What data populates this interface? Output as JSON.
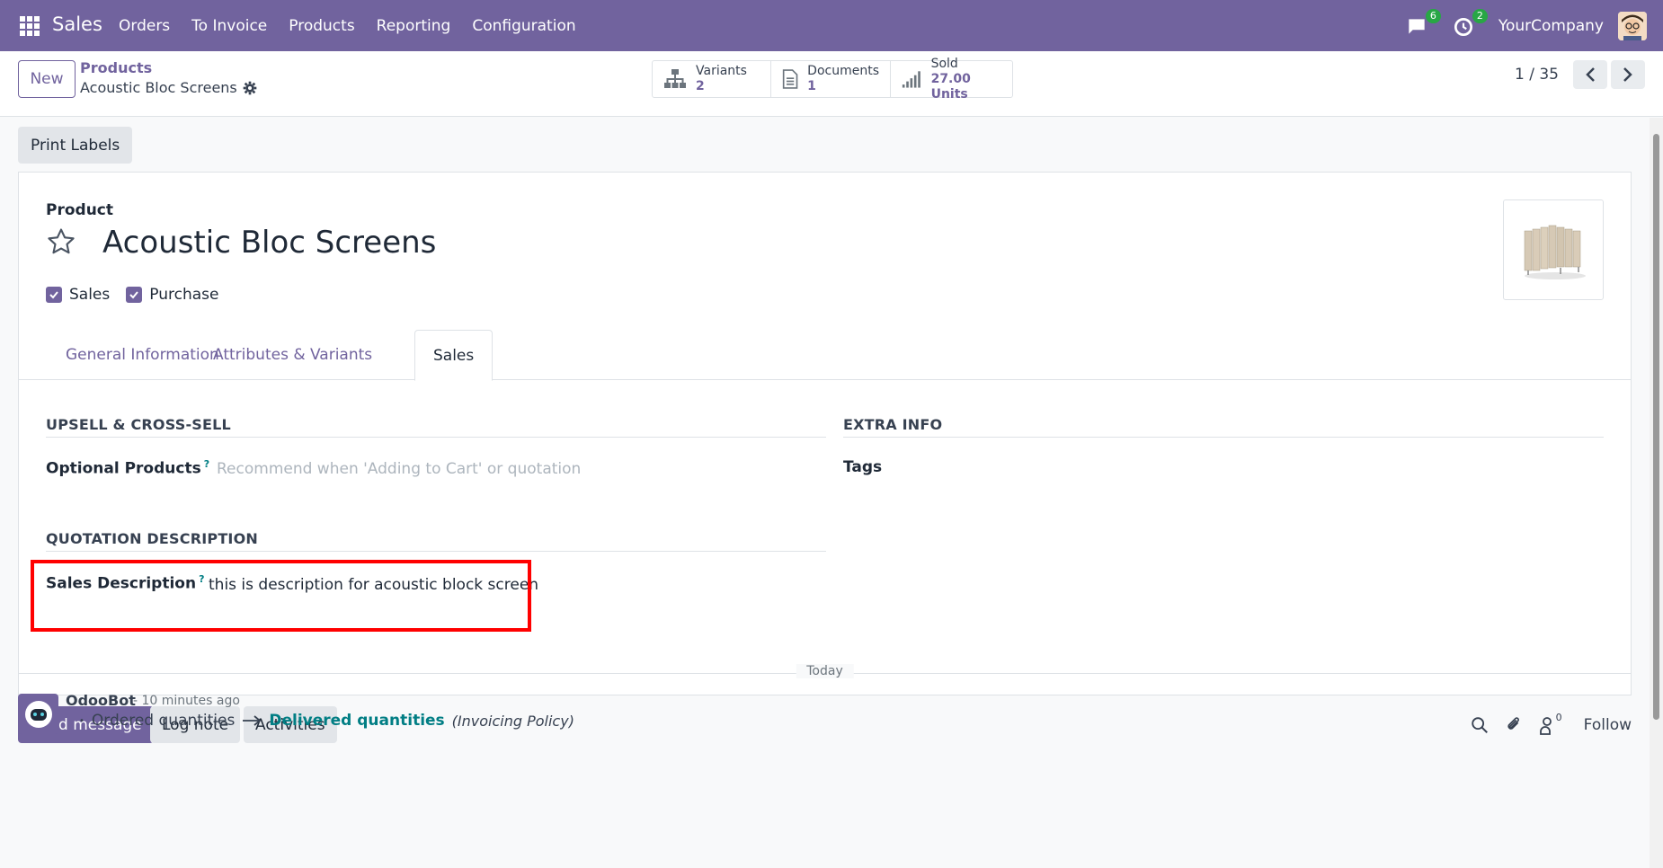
{
  "navbar": {
    "app_name": "Sales",
    "menu": [
      "Orders",
      "To Invoice",
      "Products",
      "Reporting",
      "Configuration"
    ],
    "messages_count": "6",
    "activities_count": "2",
    "company": "YourCompany"
  },
  "control": {
    "new_label": "New",
    "breadcrumb_parent": "Products",
    "breadcrumb_current": "Acoustic Bloc Screens",
    "smart_buttons": [
      {
        "label": "Variants",
        "value": "2"
      },
      {
        "label": "Documents",
        "value": "1"
      },
      {
        "label": "Sold",
        "value": "27.00 Units"
      }
    ],
    "pager": "1 / 35"
  },
  "actions": {
    "print_labels": "Print Labels"
  },
  "form": {
    "product_label": "Product",
    "product_name": "Acoustic Bloc Screens",
    "sales_check": "Sales",
    "purchase_check": "Purchase",
    "tabs": [
      "General Information",
      "Attributes & Variants",
      "Sales"
    ],
    "active_tab": "Sales",
    "upsell_title": "UPSELL & CROSS-SELL",
    "optional_products_label": "Optional Products",
    "optional_products_placeholder": "Recommend when 'Adding to Cart' or quotation",
    "extra_info_title": "EXTRA INFO",
    "tags_label": "Tags",
    "quotation_title": "QUOTATION DESCRIPTION",
    "sales_description_label": "Sales Description",
    "sales_description_value": "this is description for acoustic block screen",
    "help_mark": "?"
  },
  "chatter": {
    "send_message": "Send message",
    "log_note": "Log note",
    "activities": "Activities",
    "followers_count": "0",
    "follow": "Follow",
    "date_separator": "Today",
    "message": {
      "author": "OdooBot",
      "time": "- 10 minutes ago",
      "old_value": "Ordered quantities",
      "new_value": "Delivered quantities",
      "field": "(Invoicing Policy)"
    }
  },
  "colors": {
    "brand": "#71639e",
    "link_teal": "#017e84",
    "badge_green": "#28a745",
    "highlight_red": "#ff0000"
  }
}
